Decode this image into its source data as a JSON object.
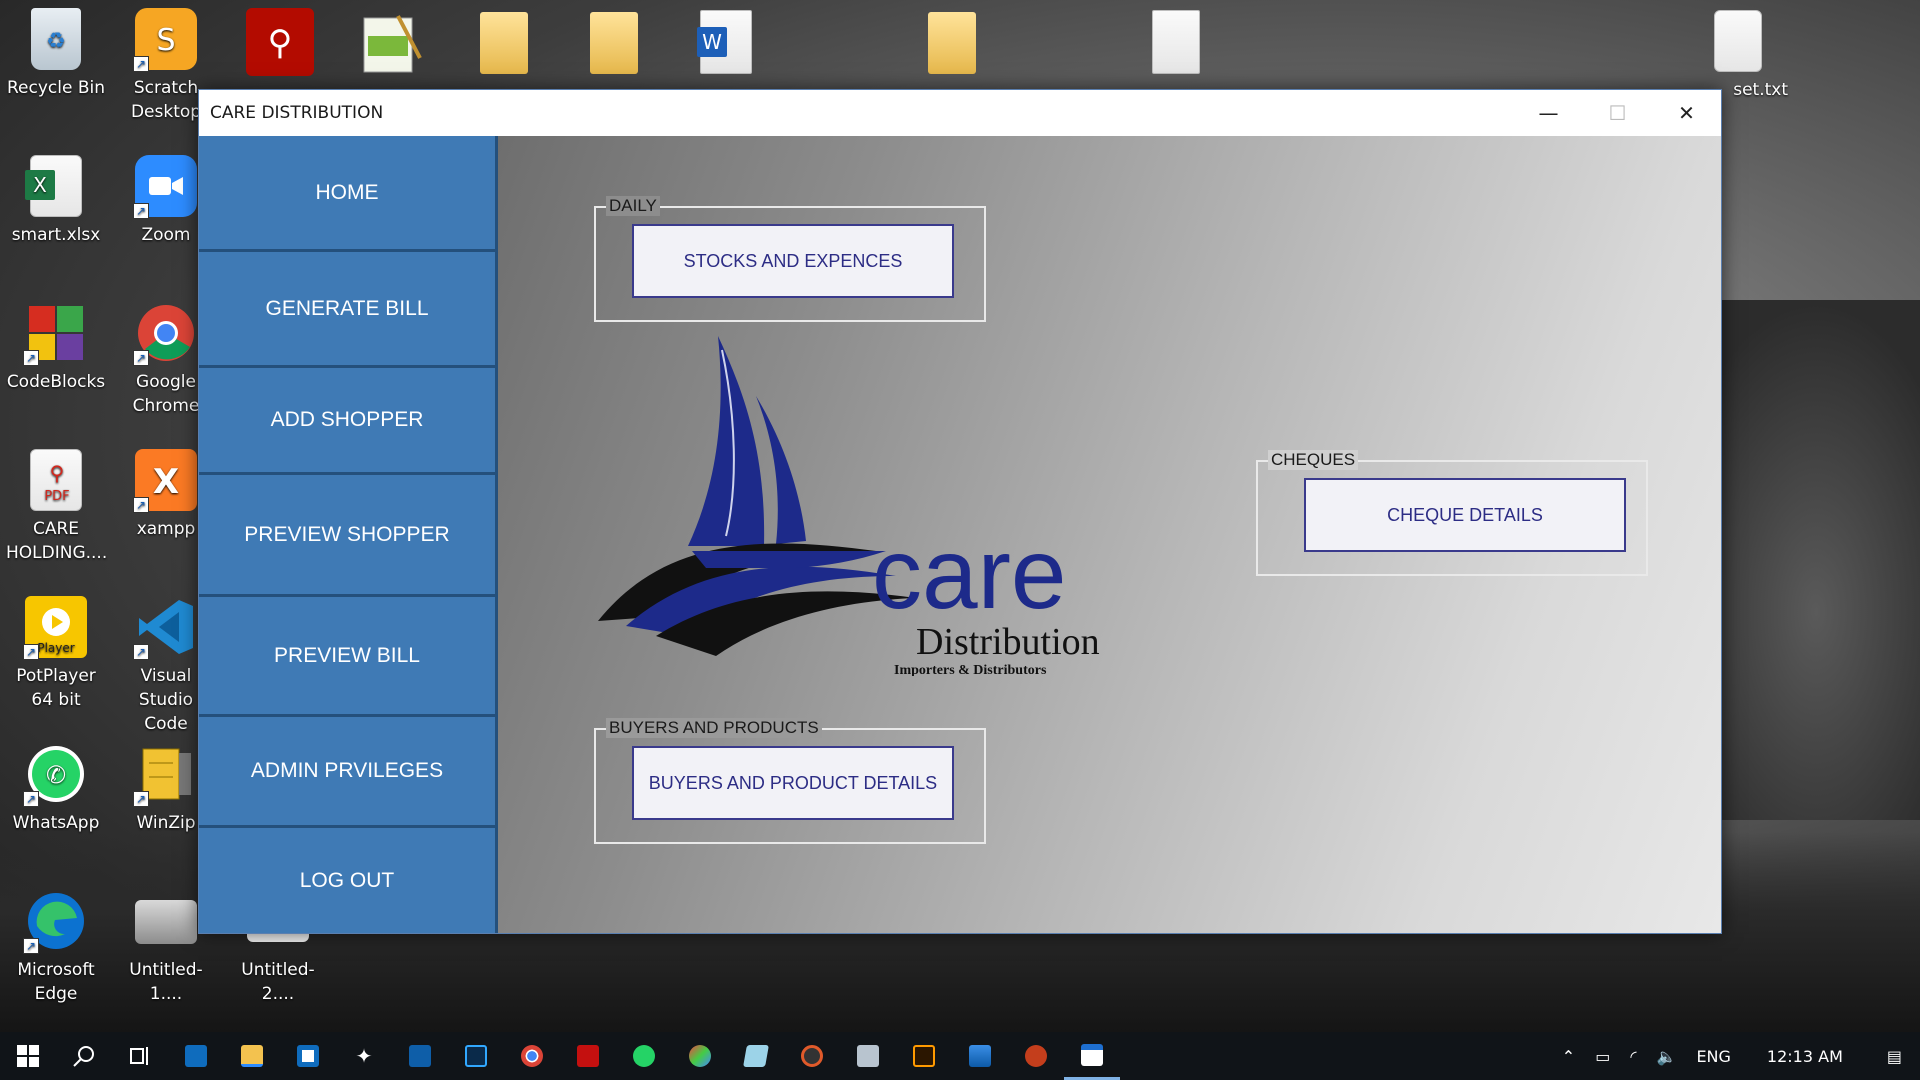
{
  "colors": {
    "sidebar_bg": "#3f7ab5",
    "sidebar_divider": "#24507c",
    "button_text": "#2d2d85",
    "logo_navy": "#1d2a8a",
    "taskbar_bg": "#101418"
  },
  "desktop": {
    "icons": [
      {
        "label": "Recycle Bin",
        "icon": "recycle-bin-icon"
      },
      {
        "label": "Scratch Desktop",
        "icon": "scratch-icon"
      },
      {
        "label": "smart.xlsx",
        "icon": "excel-icon"
      },
      {
        "label": "Zoom",
        "icon": "zoom-icon"
      },
      {
        "label": "CodeBlocks",
        "icon": "codeblocks-icon"
      },
      {
        "label": "Google Chrome",
        "icon": "chrome-icon"
      },
      {
        "label": "CARE HOLDING....",
        "icon": "pdf-icon"
      },
      {
        "label": "xampp",
        "icon": "xampp-icon"
      },
      {
        "label": "PotPlayer 64 bit",
        "icon": "potplayer-icon"
      },
      {
        "label": "Visual Studio Code",
        "icon": "vscode-icon"
      },
      {
        "label": "WhatsApp",
        "icon": "whatsapp-icon"
      },
      {
        "label": "WinZip",
        "icon": "winzip-icon"
      },
      {
        "label": "Microsoft Edge",
        "icon": "edge-icon"
      },
      {
        "label": "Untitled-1....",
        "icon": "image-file-icon"
      },
      {
        "label": "Untitled-2....",
        "icon": "image-file-icon"
      }
    ],
    "top_right_file": "set.txt"
  },
  "window": {
    "title": "CARE DISTRIBUTION",
    "minimize": "—",
    "maximize": "☐",
    "close": "✕"
  },
  "sidebar": {
    "items": [
      {
        "label": "HOME"
      },
      {
        "label": "GENERATE BILL"
      },
      {
        "label": "ADD SHOPPER"
      },
      {
        "label": "PREVIEW SHOPPER"
      },
      {
        "label": "PREVIEW BILL"
      },
      {
        "label": "ADMIN PRVILEGES"
      },
      {
        "label": "LOG OUT"
      }
    ]
  },
  "main": {
    "daily": {
      "legend": "DAILY",
      "button": "STOCKS AND EXPENCES"
    },
    "cheques": {
      "legend": "CHEQUES",
      "button": "CHEQUE DETAILS"
    },
    "buyers": {
      "legend": "BUYERS AND PRODUCTS",
      "button": "BUYERS AND PRODUCT DETAILS"
    },
    "logo": {
      "word": "care",
      "sub": "Distribution",
      "tagline": "Importers & Distributors"
    }
  },
  "taskbar": {
    "apps": [
      "start-icon",
      "search-icon",
      "task-view-icon",
      "mail-icon",
      "file-explorer-icon",
      "store-icon",
      "dropbox-icon",
      "app-icon",
      "photoshop-icon",
      "chrome-icon",
      "acrobat-icon",
      "whatsapp-icon",
      "paint-icon",
      "notepad-icon",
      "media-icon",
      "network-icon",
      "illustrator-icon",
      "photos-icon",
      "powerpoint-icon",
      "window-app-icon"
    ],
    "language": "ENG",
    "time": "12:13 AM"
  }
}
